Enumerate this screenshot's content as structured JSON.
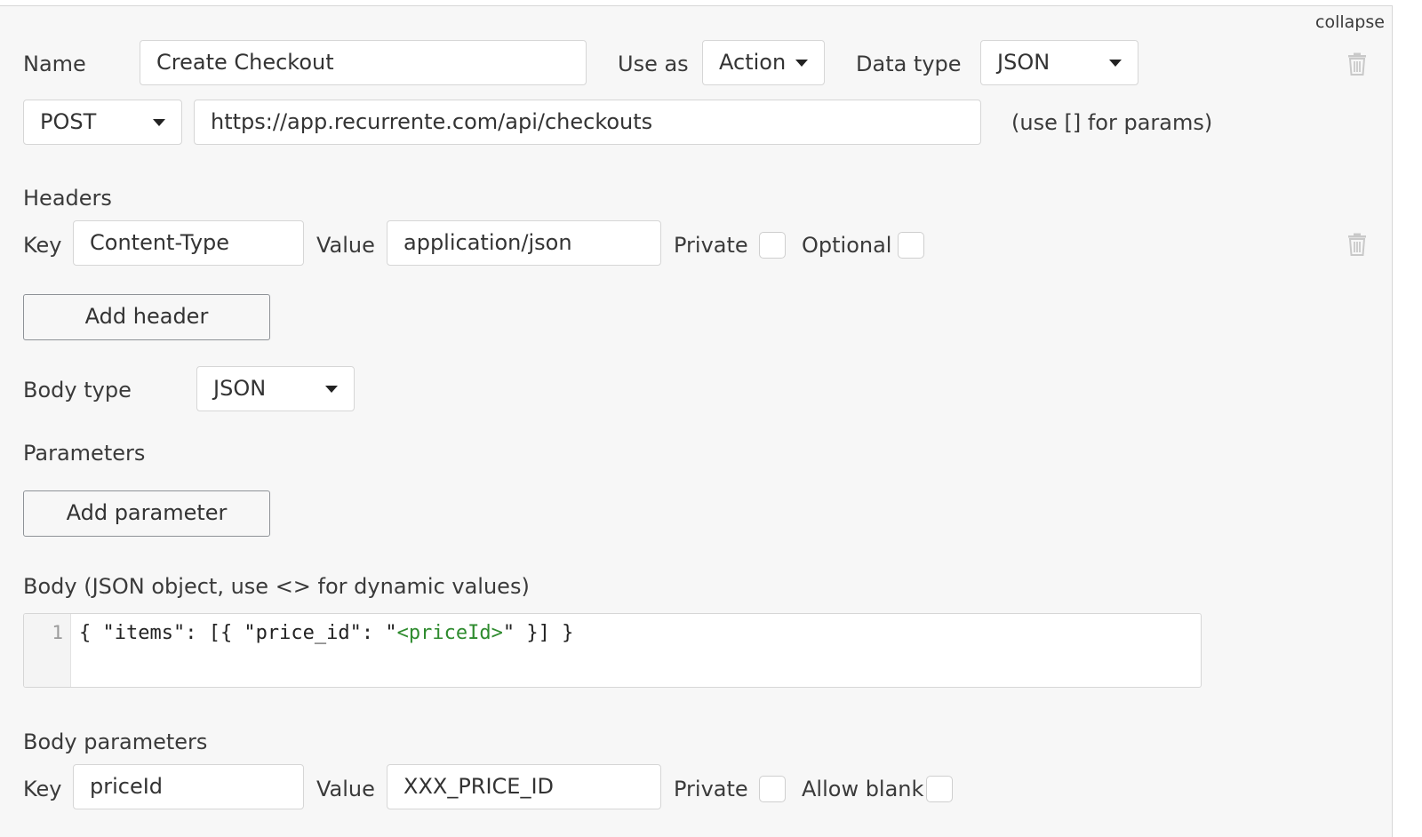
{
  "collapse_label": "collapse",
  "call": {
    "name_label": "Name",
    "name_value": "Create Checkout",
    "use_as_label": "Use as",
    "use_as_value": "Action",
    "data_type_label": "Data type",
    "data_type_value": "JSON",
    "method_value": "POST",
    "url_value": "https://app.recurrente.com/api/checkouts",
    "url_hint": "(use [] for params)"
  },
  "headers": {
    "section_label": "Headers",
    "key_label": "Key",
    "key_value": "Content-Type",
    "value_label": "Value",
    "value_value": "application/json",
    "private_label": "Private",
    "optional_label": "Optional",
    "add_button": "Add header"
  },
  "body_type": {
    "label": "Body type",
    "value": "JSON"
  },
  "parameters": {
    "section_label": "Parameters",
    "add_button": "Add parameter"
  },
  "body": {
    "label": "Body (JSON object, use <> for dynamic values)",
    "line_number": "1",
    "code_prefix": "{ \"items\": [{ \"price_id\": \"",
    "code_dynamic": "<priceId>",
    "code_suffix": "\" }] }"
  },
  "body_parameters": {
    "section_label": "Body parameters",
    "key_label": "Key",
    "key_value": "priceId",
    "value_label": "Value",
    "value_value": "XXX_PRICE_ID",
    "private_label": "Private",
    "allow_blank_label": "Allow blank"
  }
}
